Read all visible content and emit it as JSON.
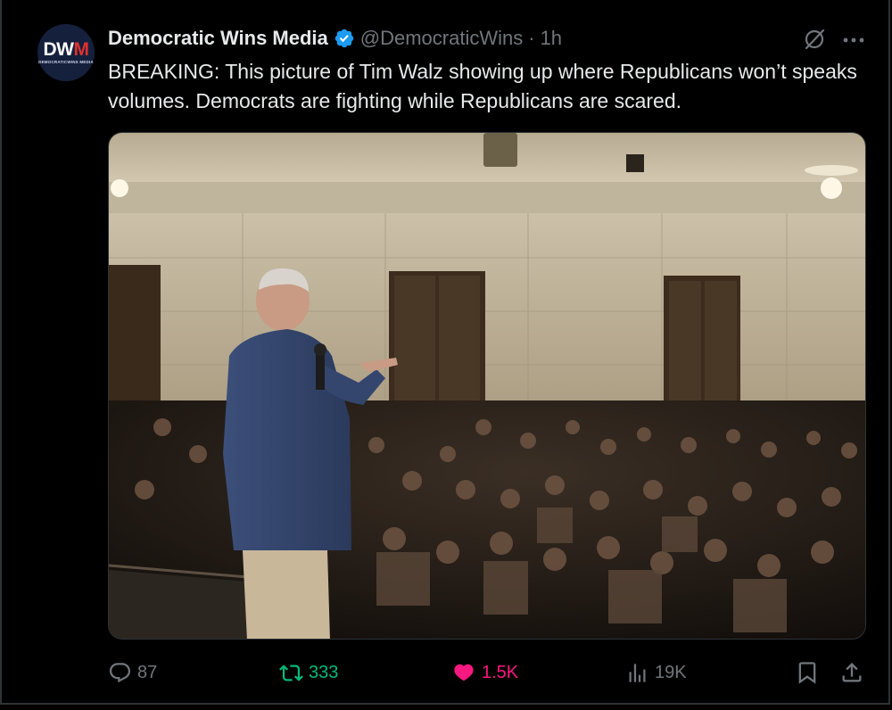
{
  "author": {
    "avatar_text_left": "DW",
    "avatar_text_right": "M",
    "avatar_subtext": "DEMOCRATICWINS MEDIA",
    "name": "Democratic Wins Media",
    "verified": true,
    "handle": "@DemocraticWins",
    "separator": "·",
    "time": "1h"
  },
  "tweet": {
    "text": "BREAKING: This picture of Tim Walz showing up where Republicans won’t speaks volumes. Democrats are fighting while Republicans are scared."
  },
  "actions": {
    "reply_count": "87",
    "retweet_count": "333",
    "like_count": "1.5K",
    "view_count": "19K"
  },
  "colors": {
    "background": "#000000",
    "text": "#e7e9ea",
    "muted": "#71767b",
    "verified_blue": "#1d9bf0",
    "retweet_green": "#00ba7c",
    "like_pink": "#f91880"
  },
  "icons": [
    "grok-icon",
    "more-icon",
    "verified-badge-icon",
    "reply-icon",
    "retweet-icon",
    "like-icon",
    "views-icon",
    "bookmark-icon",
    "share-icon"
  ]
}
